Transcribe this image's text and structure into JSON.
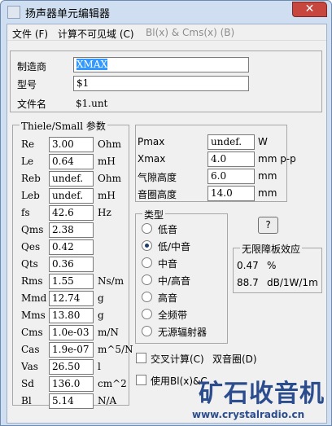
{
  "window": {
    "title": "扬声器单元编辑器",
    "close": "✕"
  },
  "menu": [
    {
      "label": "文件 (F)"
    },
    {
      "label": "计算不可见域 (C)"
    },
    {
      "label": "Bl(x) & Cms(x) (B)"
    }
  ],
  "header": {
    "maker_label": "制造商",
    "maker_value": "XMAX",
    "model_label": "型号",
    "model_value": "$1",
    "file_label": "文件名",
    "file_value": "$1.unt"
  },
  "ts": {
    "title": "Thiele/Small 参数",
    "rows": [
      {
        "name": "Re",
        "value": "3.00",
        "unit": "Ohm"
      },
      {
        "name": "Le",
        "value": "0.64",
        "unit": "mH"
      },
      {
        "name": "Reb",
        "value": "undef.",
        "unit": "Ohm"
      },
      {
        "name": "Leb",
        "value": "undef.",
        "unit": "mH"
      },
      {
        "name": "fs",
        "value": "42.6",
        "unit": "Hz"
      },
      {
        "name": "Qms",
        "value": "2.38",
        "unit": ""
      },
      {
        "name": "Qes",
        "value": "0.42",
        "unit": ""
      },
      {
        "name": "Qts",
        "value": "0.36",
        "unit": ""
      },
      {
        "name": "Rms",
        "value": "1.55",
        "unit": "Ns/m"
      },
      {
        "name": "Mmd",
        "value": "12.74",
        "unit": "g"
      },
      {
        "name": "Mms",
        "value": "13.80",
        "unit": "g"
      },
      {
        "name": "Cms",
        "value": "1.0e-03",
        "unit": "m/N"
      },
      {
        "name": "Cas",
        "value": "1.9e-07",
        "unit": "m^5/N"
      },
      {
        "name": "Vas",
        "value": "26.50",
        "unit": "l"
      },
      {
        "name": "Sd",
        "value": "136.0",
        "unit": "cm^2"
      },
      {
        "name": "Bl",
        "value": "5.14",
        "unit": "N/A"
      }
    ]
  },
  "mech": {
    "rows": [
      {
        "name": "Pmax",
        "value": "undef.",
        "unit": "W"
      },
      {
        "name": "Xmax",
        "value": "4.0",
        "unit": "mm p-p"
      },
      {
        "name": "气隙高度",
        "value": "6.0",
        "unit": "mm"
      },
      {
        "name": "音圈高度",
        "value": "14.0",
        "unit": "mm"
      }
    ]
  },
  "type": {
    "title": "类型",
    "options": [
      "低音",
      "低/中音",
      "中音",
      "中/高音",
      "高音",
      "全频带",
      "无源辐射器"
    ],
    "selected_index": 1
  },
  "help_button": "?",
  "baffle": {
    "title": "无限障板效应",
    "row1_value": "0.47",
    "row1_unit": "%",
    "row2_value": "88.7",
    "row2_unit": "dB/1W/1m"
  },
  "checks": {
    "cross_calc": "交叉计算(C)",
    "dual_coil": "双音圈(D)",
    "use_bl": "使用Bl(x)&C"
  },
  "watermark": {
    "logo": "矿石收音机",
    "url": "www.crystalradio.cn"
  },
  "colors": {
    "accent": "#3399ff",
    "brand": "#2b4d8e"
  }
}
